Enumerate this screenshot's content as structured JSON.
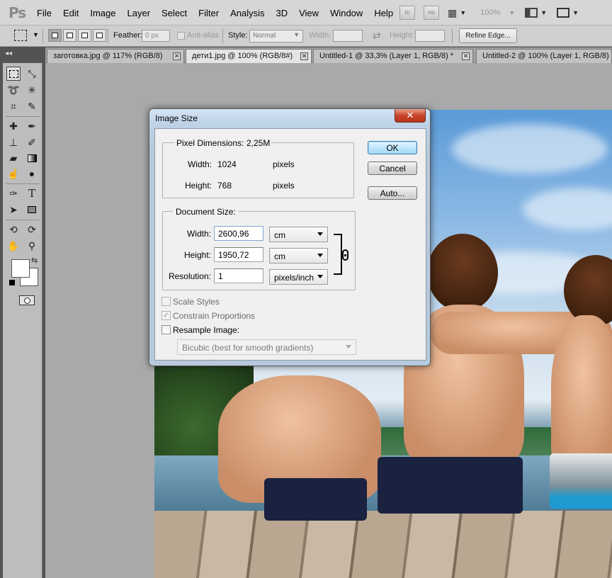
{
  "app": {
    "logo": "Ps"
  },
  "menu": [
    "File",
    "Edit",
    "Image",
    "Layer",
    "Select",
    "Filter",
    "Analysis",
    "3D",
    "View",
    "Window",
    "Help"
  ],
  "menubar_right": {
    "bridge": "Br",
    "minibridge": "Mb",
    "zoom": "100%"
  },
  "options": {
    "feather_label": "Feather:",
    "feather_value": "0 px",
    "antialias_label": "Anti-alias",
    "style_label": "Style:",
    "style_value": "Normal",
    "width_label": "Width:",
    "height_label": "Height:",
    "refine_label": "Refine Edge..."
  },
  "tabs": [
    {
      "label": "заготовка.jpg @ 117% (RGB/8)",
      "active": false
    },
    {
      "label": "дети1.jpg @ 100% (RGB/8#)",
      "active": true
    },
    {
      "label": "Untitled-1 @ 33,3% (Layer 1, RGB/8) *",
      "active": false
    },
    {
      "label": "Untitled-2 @ 100% (Layer 1, RGB/8)",
      "active": false
    }
  ],
  "tools_panel_collapse": "◂◂",
  "dialog": {
    "title": "Image Size",
    "close": "✕",
    "pixel_dimensions": {
      "label": "Pixel Dimensions:",
      "size": "2,25M",
      "width_label": "Width:",
      "width_value": "1024",
      "width_unit": "pixels",
      "height_label": "Height:",
      "height_value": "768",
      "height_unit": "pixels"
    },
    "document_size": {
      "label": "Document Size:",
      "width_label": "Width:",
      "width_value": "2600,96",
      "width_unit": "cm",
      "height_label": "Height:",
      "height_value": "1950,72",
      "height_unit": "cm",
      "resolution_label": "Resolution:",
      "resolution_value": "1",
      "resolution_unit": "pixels/inch"
    },
    "scale_styles": {
      "label": "Scale Styles",
      "checked": false,
      "enabled": false
    },
    "constrain": {
      "label": "Constrain Proportions",
      "checked": true,
      "enabled": false
    },
    "resample": {
      "label": "Resample Image:",
      "checked": false,
      "enabled": true
    },
    "resample_method": "Bicubic (best for smooth gradients)",
    "buttons": {
      "ok": "OK",
      "cancel": "Cancel",
      "auto": "Auto..."
    }
  }
}
